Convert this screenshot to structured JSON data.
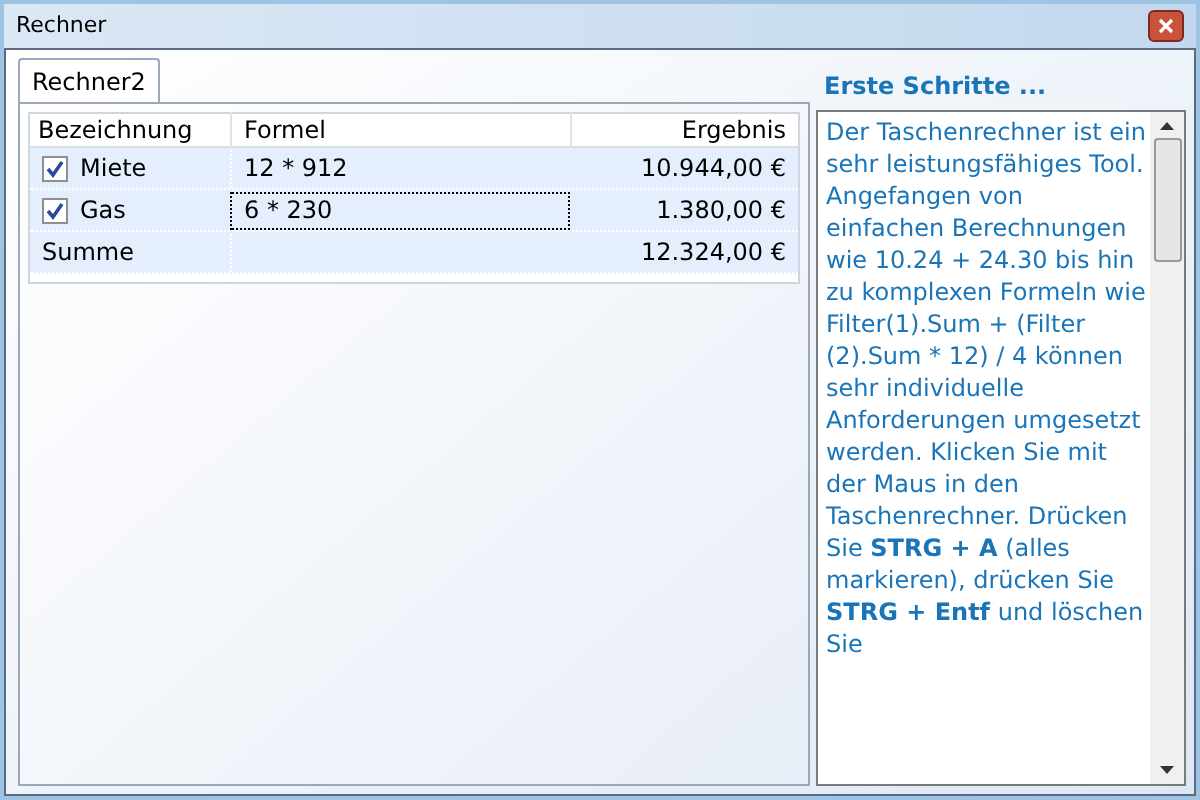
{
  "window": {
    "title": "Rechner"
  },
  "tabs": [
    {
      "label": "Rechner2",
      "selected": true
    }
  ],
  "table": {
    "columns": [
      "Bezeichnung",
      "Formel",
      "Ergebnis"
    ],
    "rows": [
      {
        "kind": "item",
        "checked": true,
        "name": "Miete",
        "formula": "12 * 912",
        "focused": false,
        "result": "10.944,00 €"
      },
      {
        "kind": "item",
        "checked": true,
        "name": "Gas",
        "formula": "6 * 230",
        "focused": true,
        "result": "1.380,00 €"
      },
      {
        "kind": "total",
        "name": "Summe",
        "result": "12.324,00 €"
      }
    ]
  },
  "help": {
    "title": "Erste Schritte ...",
    "text": "Der Taschenrechner ist ein sehr leistungsfähiges Tool. Angefangen von einfachen Berechnungen wie 10.24 + 24.30 bis hin zu komplexen Formeln wie Filter(1).Sum + (Filter (2).Sum * 12) / 4 können sehr individuelle Anforderungen umgesetzt werden. Klicken Sie mit der Maus in den Taschenrechner. Drücken Sie **STRG + A** (alles markieren), drücken Sie **STRG + Entf** und löschen Sie"
  }
}
